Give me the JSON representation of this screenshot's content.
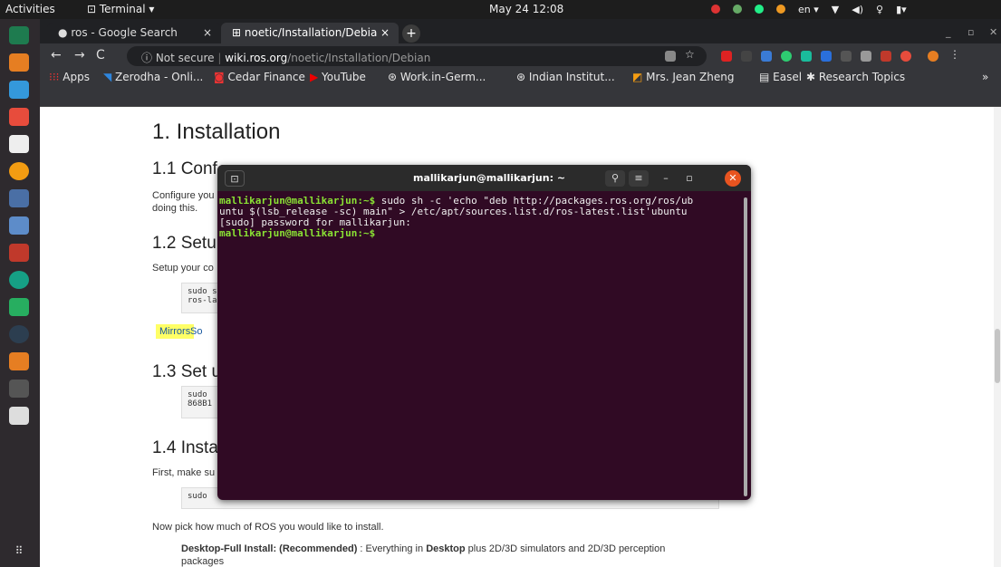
{
  "topbar": {
    "activities": "Activities",
    "app_menu": "⊡ Terminal ▾",
    "clock": "May 24  12:08",
    "lang": "en ▾"
  },
  "dock": {
    "icons": [
      "pycharm-icon",
      "sublime-icon",
      "files-icon",
      "software-center-icon",
      "terminal-app-icon",
      "chrome-icon",
      "vscode-icon",
      "git-icon",
      "filezilla-icon",
      "arduino-icon",
      "ros-icon",
      "eclipse-icon",
      "blender-icon",
      "terminal-active-icon",
      "usb-icon",
      "show-apps-icon"
    ]
  },
  "browser": {
    "tabs": [
      {
        "label": "ros - Google Search",
        "close": "×"
      },
      {
        "label": "noetic/Installation/Debia",
        "close": "×"
      }
    ],
    "new_tab": "+",
    "address": {
      "security": "ⓘ Not secure",
      "host": "wiki.ros.org",
      "path": "/noetic/Installation/Debian"
    },
    "bookmarks": [
      "Apps",
      "Zerodha - Onli...",
      "Cedar Finance",
      "YouTube",
      "Work.in-Germ...",
      "Indian Institut...",
      "Mrs. Jean Zheng",
      "Easel",
      "Research Topics"
    ],
    "more": "»"
  },
  "page": {
    "h1": "1. Installation",
    "s11": "1.1 Conf",
    "s11_text1": "Configure you",
    "s11_text2": "doing this.",
    "s12": "1.2 Setu",
    "s12_text": "Setup your co",
    "code1_line1": "sudo s",
    "code1_line2": "ros-la",
    "mirrors": "Mirrors",
    "so": "So",
    "s13": "1.3 Set u",
    "code2_line1": "sudo",
    "code2_line2": "868B1",
    "s14": "1.4 Insta",
    "s14_text": "First, make su",
    "code3": "sudo",
    "pick_text": "Now pick how much of ROS you would like to install.",
    "desktop_full_label": "Desktop-Full Install: (Recommended)",
    "desktop_full_text_1": " : Everything in ",
    "desktop_full_bold": "Desktop",
    "desktop_full_text_2": " plus 2D/3D simulators and 2D/3D perception",
    "desktop_full_text_3": "packages"
  },
  "terminal": {
    "title": "mallikarjun@mallikarjun: ~",
    "line1_prompt": "mallikarjun@mallikarjun:~$",
    "line1_cmd": " sudo sh -c 'echo \"deb http://packages.ros.org/ros/ub",
    "line2": "untu $(lsb_release -sc) main\" > /etc/apt/sources.list.d/ros-latest.list'ubuntu",
    "line3": "[sudo] password for mallikarjun:",
    "line4_prompt": "mallikarjun@mallikarjun:~$"
  }
}
